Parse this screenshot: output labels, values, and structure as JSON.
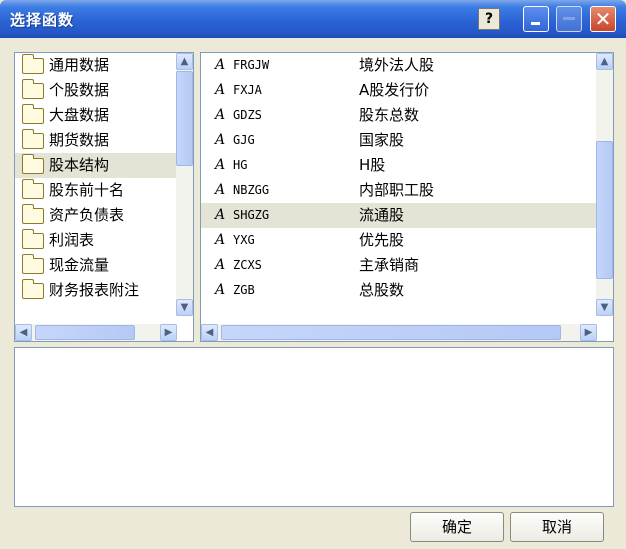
{
  "window": {
    "title": "选择函数"
  },
  "titlebar_icons": [
    "help-icon",
    "minimize-icon",
    "maximize-icon",
    "close-icon"
  ],
  "help_label": "?",
  "close_label": "✕",
  "categories": [
    {
      "label": "通用数据"
    },
    {
      "label": "个股数据"
    },
    {
      "label": "大盘数据"
    },
    {
      "label": "期货数据"
    },
    {
      "label": "股本结构",
      "selected": true
    },
    {
      "label": "股东前十名"
    },
    {
      "label": "资产负债表"
    },
    {
      "label": "利润表"
    },
    {
      "label": "现金流量"
    },
    {
      "label": "财务报表附注"
    }
  ],
  "functions": [
    {
      "code": "FRGJW",
      "desc": "境外法人股"
    },
    {
      "code": "FXJA",
      "desc": "A股发行价"
    },
    {
      "code": "GDZS",
      "desc": "股东总数"
    },
    {
      "code": "GJG",
      "desc": "国家股"
    },
    {
      "code": "HG",
      "desc": "H股"
    },
    {
      "code": "NBZGG",
      "desc": "内部职工股"
    },
    {
      "code": "SHGZG",
      "desc": "流通股",
      "selected": true
    },
    {
      "code": "YXG",
      "desc": "优先股"
    },
    {
      "code": "ZCXS",
      "desc": "主承销商"
    },
    {
      "code": "ZGB",
      "desc": "总股数"
    }
  ],
  "fn_icon_glyph": "A",
  "description_text": "",
  "buttons": {
    "ok": "确定",
    "cancel": "取消"
  },
  "colors": {
    "title_bar": "#2c63d4",
    "selection": "#e3e3d6",
    "border": "#7f9db9"
  }
}
